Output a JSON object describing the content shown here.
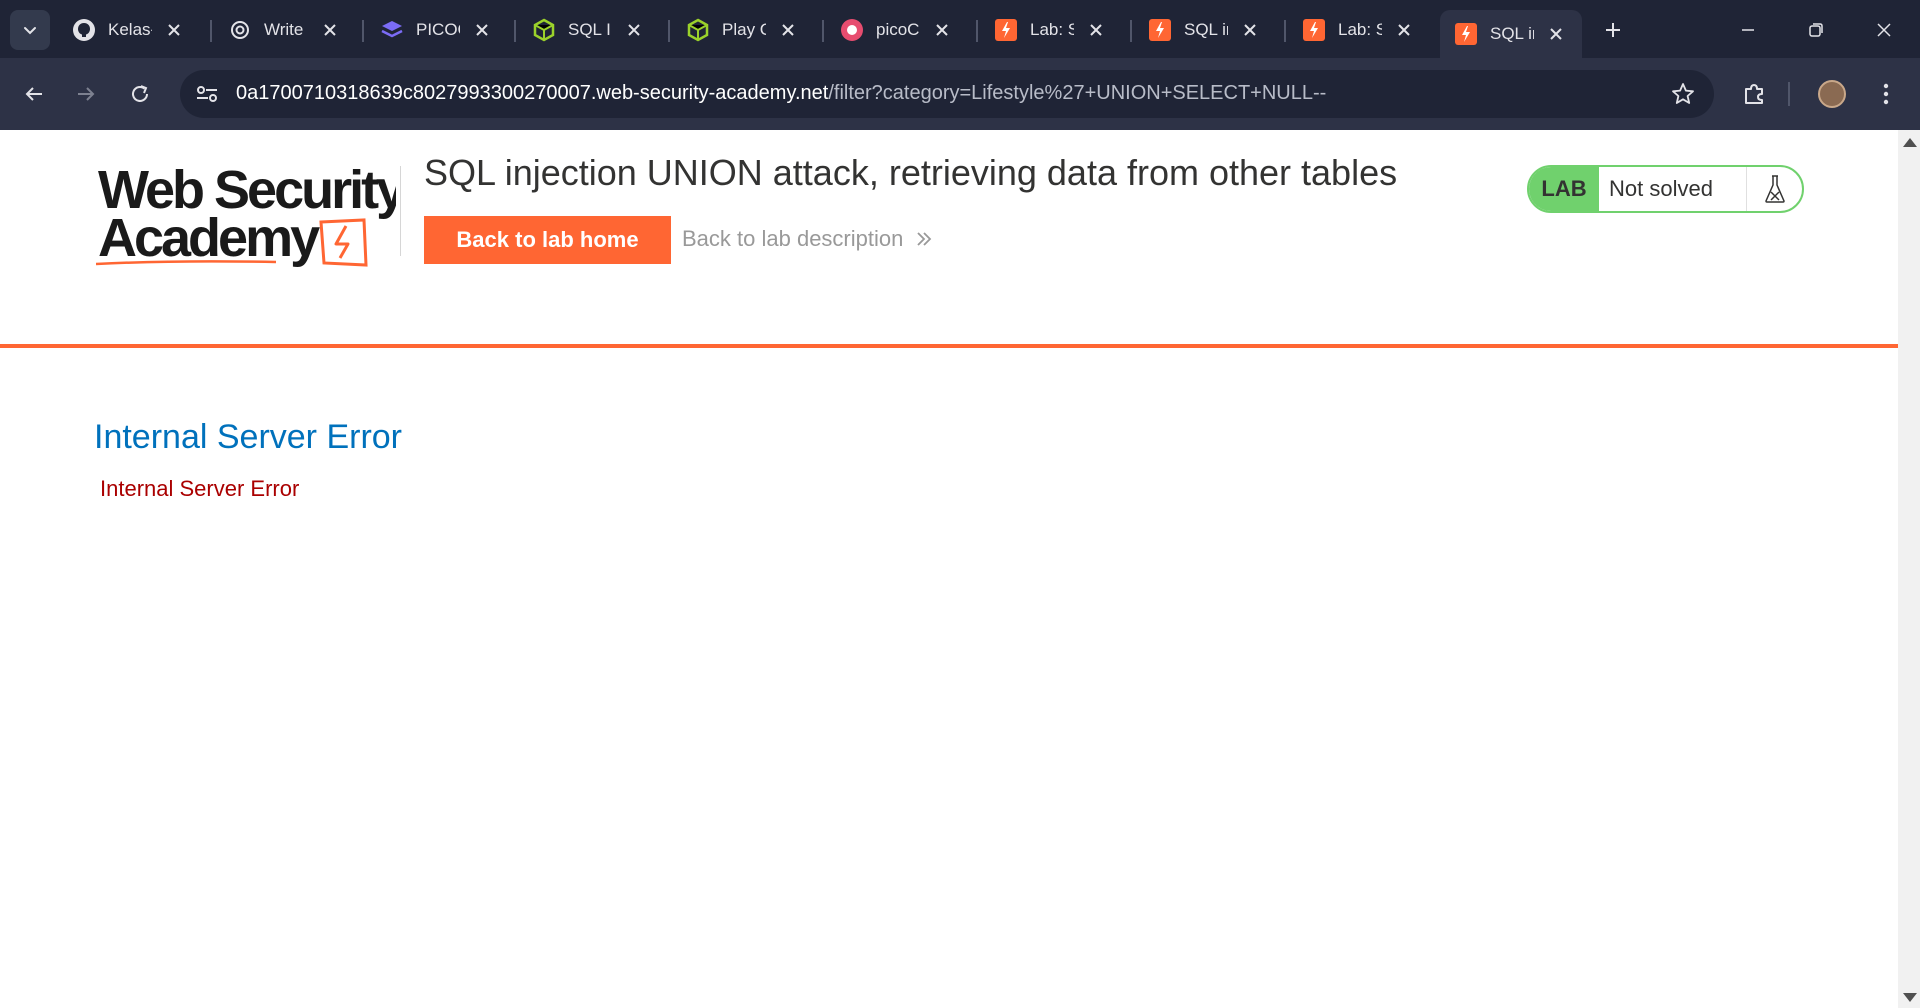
{
  "browser": {
    "tabs": [
      {
        "label": "Kelas-",
        "icon": "github-icon"
      },
      {
        "label": "Write",
        "icon": "openai-icon"
      },
      {
        "label": "PICOC",
        "icon": "layers-icon"
      },
      {
        "label": "SQL Ir",
        "icon": "hexagon-icon"
      },
      {
        "label": "Play C",
        "icon": "hexagon-icon"
      },
      {
        "label": "picoC",
        "icon": "picoctf-icon"
      },
      {
        "label": "Lab: S",
        "icon": "portswigger-icon"
      },
      {
        "label": "SQL ir",
        "icon": "portswigger-icon"
      },
      {
        "label": "Lab: S",
        "icon": "portswigger-icon"
      },
      {
        "label": "SQL ir",
        "icon": "portswigger-icon",
        "active": true
      }
    ],
    "url_host": "0a1700710318639c8027993300270007.web-security-academy.net",
    "url_path": "/filter?category=Lifestyle%27+UNION+SELECT+NULL--"
  },
  "header": {
    "logo_line1": "Web Security",
    "logo_line2": "Academy",
    "title": "SQL injection UNION attack, retrieving data from other tables",
    "back_home": "Back to lab home",
    "back_desc": "Back to lab description",
    "lab_tag": "LAB",
    "lab_state": "Not solved"
  },
  "content": {
    "heading": "Internal Server Error",
    "message": "Internal Server Error"
  },
  "colors": {
    "accent": "#ff6633",
    "lab_green": "#70d16d",
    "error_heading": "#0071bc",
    "error_text": "#aa0000"
  }
}
